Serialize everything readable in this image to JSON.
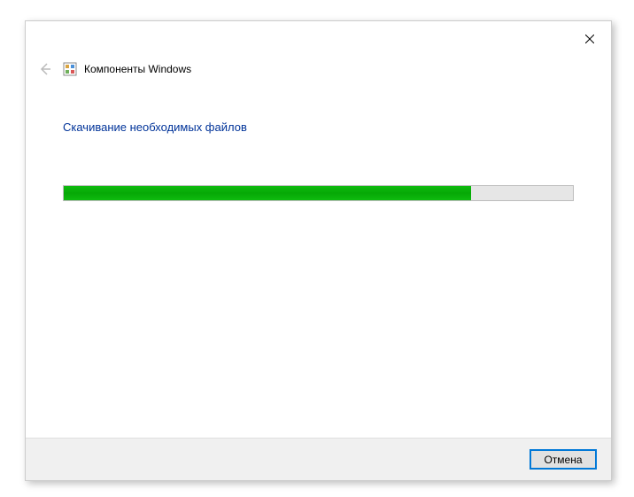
{
  "header": {
    "title": "Компоненты Windows"
  },
  "content": {
    "status_text": "Скачивание необходимых файлов",
    "progress_percent": 80
  },
  "footer": {
    "cancel_label": "Отмена"
  },
  "icons": {
    "close": "close-icon",
    "back": "back-arrow-icon",
    "app": "windows-features-icon"
  }
}
